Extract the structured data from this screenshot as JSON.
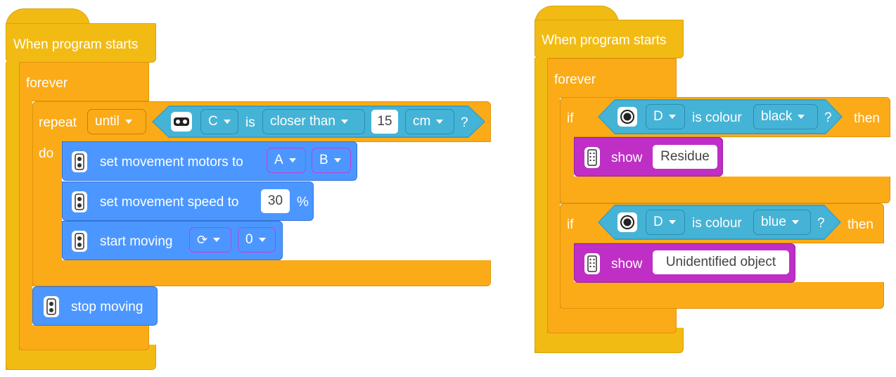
{
  "left_script": {
    "hat_label": "When program starts",
    "forever_label": "forever",
    "repeat": {
      "label": "repeat",
      "mode": "until",
      "do_label": "do",
      "condition": {
        "icon": "distance-sensor-icon",
        "port": "C",
        "is_label": "is",
        "comparison": "closer than",
        "value": "15",
        "unit": "cm",
        "question": "?"
      }
    },
    "set_motors": {
      "label": "set movement motors to",
      "port_a": "A",
      "port_b": "B",
      "icon": "motor-pair-icon"
    },
    "set_speed": {
      "label": "set movement speed to",
      "value": "30",
      "unit": "%",
      "icon": "motor-pair-icon"
    },
    "start_moving": {
      "label": "start moving",
      "direction_icon": "rotate-clockwise-icon",
      "value": "0",
      "icon": "motor-pair-icon"
    },
    "stop_moving": {
      "label": "stop moving",
      "icon": "motor-pair-icon"
    }
  },
  "right_script": {
    "hat_label": "When program starts",
    "forever_label": "forever",
    "if_blocks": [
      {
        "if_label": "if",
        "then_label": "then",
        "condition": {
          "icon": "color-sensor-icon",
          "port": "D",
          "is_label": "is colour",
          "color": "black",
          "question": "?"
        },
        "show": {
          "label": "show",
          "text": "Residue",
          "icon": "light-matrix-icon"
        }
      },
      {
        "if_label": "if",
        "then_label": "then",
        "condition": {
          "icon": "color-sensor-icon",
          "port": "D",
          "is_label": "is colour",
          "color": "blue",
          "question": "?"
        },
        "show": {
          "label": "show",
          "text": "Unidentified object",
          "icon": "light-matrix-icon"
        }
      }
    ]
  },
  "colors": {
    "events": "#f2bb14",
    "control": "#fbab18",
    "motors": "#4c97ff",
    "display": "#bf2fc6",
    "sensors": "#45b3d6"
  }
}
